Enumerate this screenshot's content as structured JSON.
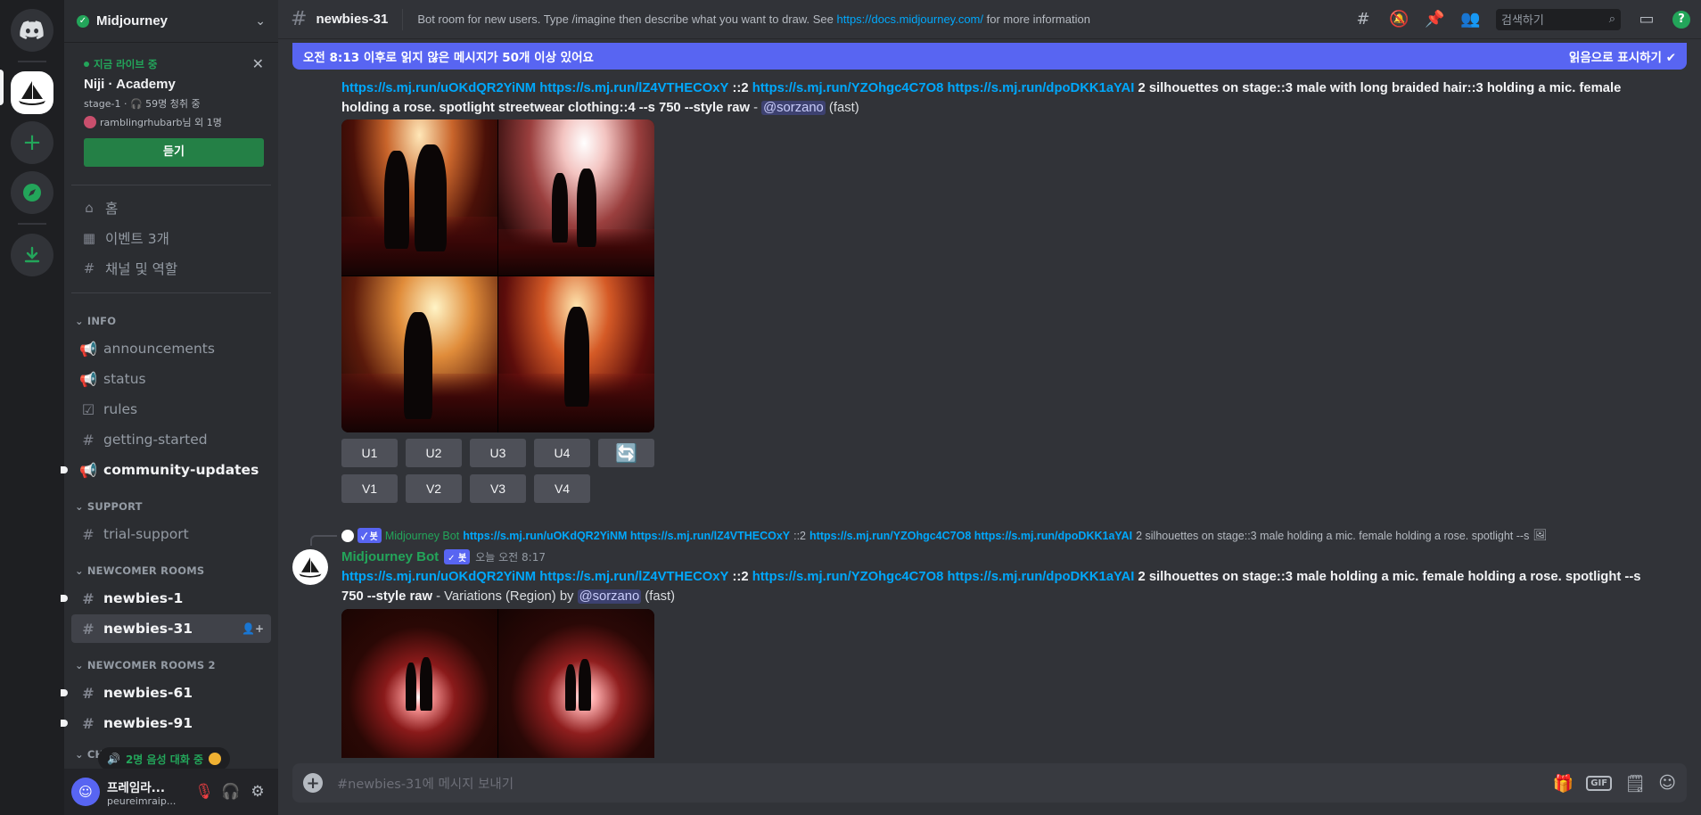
{
  "server": {
    "name": "Midjourney"
  },
  "stage": {
    "live_label": "지금 라이브 중",
    "title": "Niji · Academy",
    "meta": "stage-1 · 🎧 59명 청취 중",
    "users": "ramblingrhubarb님 외 1명",
    "listen_label": "듣기"
  },
  "nav": [
    {
      "label": "홈",
      "icon": "home-icon"
    },
    {
      "label": "이벤트 3개",
      "icon": "calendar-icon"
    },
    {
      "label": "채널 및 역할",
      "icon": "channels-roles-icon"
    }
  ],
  "categories": [
    {
      "name": "INFO",
      "channels": [
        {
          "name": "announcements",
          "icon": "megaphone-icon",
          "unread": false
        },
        {
          "name": "status",
          "icon": "megaphone-icon",
          "unread": false
        },
        {
          "name": "rules",
          "icon": "checkbox-icon",
          "unread": false
        },
        {
          "name": "getting-started",
          "icon": "hash-icon",
          "unread": false
        },
        {
          "name": "community-updates",
          "icon": "megaphone-icon",
          "unread": true
        }
      ]
    },
    {
      "name": "SUPPORT",
      "channels": [
        {
          "name": "trial-support",
          "icon": "hash-icon",
          "unread": false
        }
      ]
    },
    {
      "name": "NEWCOMER ROOMS",
      "channels": [
        {
          "name": "newbies-1",
          "icon": "threads-icon",
          "unread": true
        },
        {
          "name": "newbies-31",
          "icon": "threads-icon",
          "unread": false,
          "selected": true
        }
      ]
    },
    {
      "name": "NEWCOMER ROOMS 2",
      "channels": [
        {
          "name": "newbies-61",
          "icon": "threads-icon",
          "unread": true
        },
        {
          "name": "newbies-91",
          "icon": "threads-icon",
          "unread": true
        }
      ]
    },
    {
      "name": "CHAT",
      "channels": []
    }
  ],
  "voice_pill": "2명 음성 대화 중",
  "user_panel": {
    "name": "프레임라...",
    "sub": "peureimraip..."
  },
  "topbar": {
    "channel": "newbies-31",
    "topic_pre": "Bot room for new users. Type /imagine then describe what you want to draw. See ",
    "topic_link": "https://docs.midjourney.com/",
    "topic_post": " for more information",
    "search_placeholder": "검색하기"
  },
  "banner": {
    "text": "오전 8:13 이후로 읽지 않은 메시지가 50개 이상 있어요",
    "action": "읽음으로 표시하기"
  },
  "message1": {
    "link1": "https://s.mj.run/uOKdQR2YiNM",
    "link2": "https://s.mj.run/lZ4VTHECOxY",
    "weight": "::2",
    "link3": "https://s.mj.run/YZOhgc4C7O8",
    "link4": "https://s.mj.run/dpoDKK1aYAI",
    "prompt": "2 silhouettes on stage::3 male with long braided hair::3 holding a mic. female holding a rose. spotlight streetwear clothing::4 --s 750 --style raw",
    "dash": " - ",
    "mention": "@sorzano",
    "speed": "(fast)",
    "buttons_u": [
      "U1",
      "U2",
      "U3",
      "U4"
    ],
    "buttons_v": [
      "V1",
      "V2",
      "V3",
      "V4"
    ]
  },
  "message2": {
    "reply_author": "Midjourney Bot",
    "reply_tag": "✓ 봇",
    "reply_links": "https://s.mj.run/uOKdQR2YiNM https://s.mj.run/lZ4VTHECOxY",
    "reply_weight": "::2",
    "reply_links2": "https://s.mj.run/YZOhgc4C7O8 https://s.mj.run/dpoDKK1aYAI",
    "reply_text": "2 silhouettes on stage::3 male holding a mic. female holding a rose. spotlight --s",
    "author": "Midjourney Bot",
    "tag": "✓ 봇",
    "time": "오늘 오전 8:17",
    "link1": "https://s.mj.run/uOKdQR2YiNM",
    "link2": "https://s.mj.run/lZ4VTHECOxY",
    "weight": "::2",
    "link3": "https://s.mj.run/YZOhgc4C7O8",
    "link4": "https://s.mj.run/dpoDKK1aYAI",
    "prompt": "2 silhouettes on stage::3 male holding a mic. female holding a rose. spotlight --s 750 --style raw",
    "suffix": " - Variations (Region) by ",
    "mention": "@sorzano",
    "speed": "(fast)"
  },
  "composer": {
    "placeholder": "#newbies-31에 메시지 보내기"
  }
}
